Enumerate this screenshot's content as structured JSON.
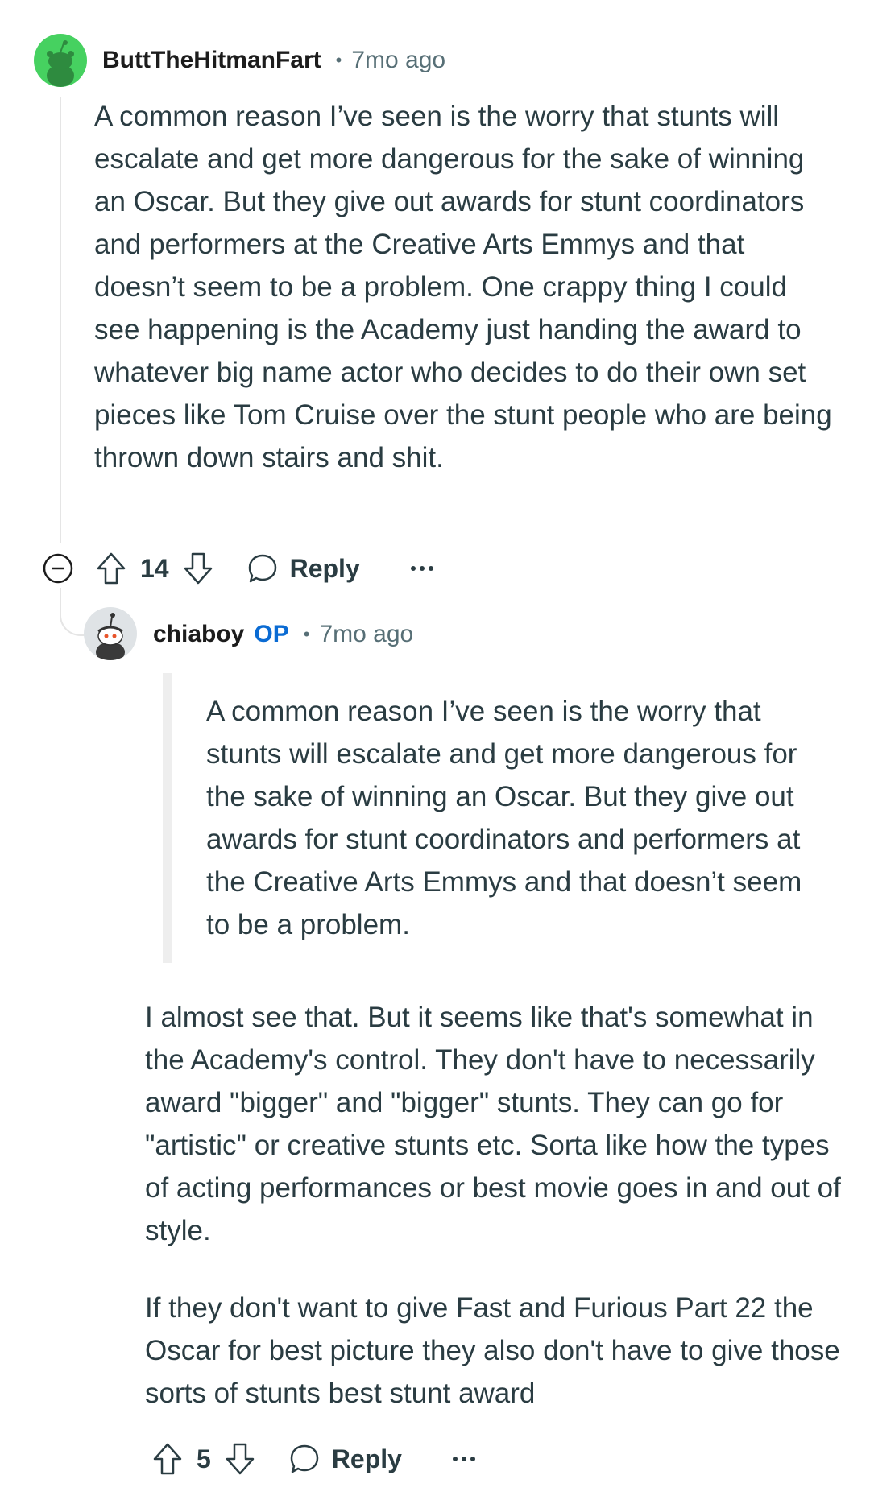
{
  "colors": {
    "avatar1_bg": "#46d160",
    "op_badge": "#0a6bd3",
    "meta_text": "#576f76",
    "body_text": "#2a3c42",
    "thread_line": "#e5e5e5"
  },
  "comments": [
    {
      "author": "ButtTheHitmanFart",
      "separator": "•",
      "time": "7mo ago",
      "avatar_icon": "snoo-avatar-icon",
      "body": "A common reason I’ve seen is the worry that stunts will escalate and get more dangerous for the sake of winning an Oscar. But they give out awards for stunt coordinators and performers at the Creative Arts Emmys and that doesn’t seem to be a problem. One crappy thing I could see happening is the Academy just handing the award to whatever big name actor who decides to do their own set pieces like Tom Cruise over the stunt people who are being thrown down stairs and shit.",
      "votes": "14",
      "reply_label": "Reply",
      "collapse_icon": "minus-circle-icon"
    },
    {
      "author": "chiaboy",
      "badge": "OP",
      "separator": "•",
      "time": "7mo ago",
      "avatar_icon": "snoo-avatar-icon",
      "quote": "A common reason I’ve seen is the worry that stunts will escalate and get more dangerous for the sake of winning an Oscar. But they give out awards for stunt coordinators and performers at the Creative Arts Emmys and that doesn’t seem to be a problem.",
      "paragraphs": [
        "I almost see that. But it seems like that's somewhat in the Academy's control. They don't have to necessarily award \"bigger\" and \"bigger\" stunts. They can go for \"artistic\" or creative stunts etc. Sorta like how the types of acting performances or best movie goes in and out of style.",
        "If they don't want to give Fast and Furious Part 22 the Oscar for best picture they also don't have to give those sorts of stunts best stunt award"
      ],
      "votes": "5",
      "reply_label": "Reply"
    }
  ]
}
